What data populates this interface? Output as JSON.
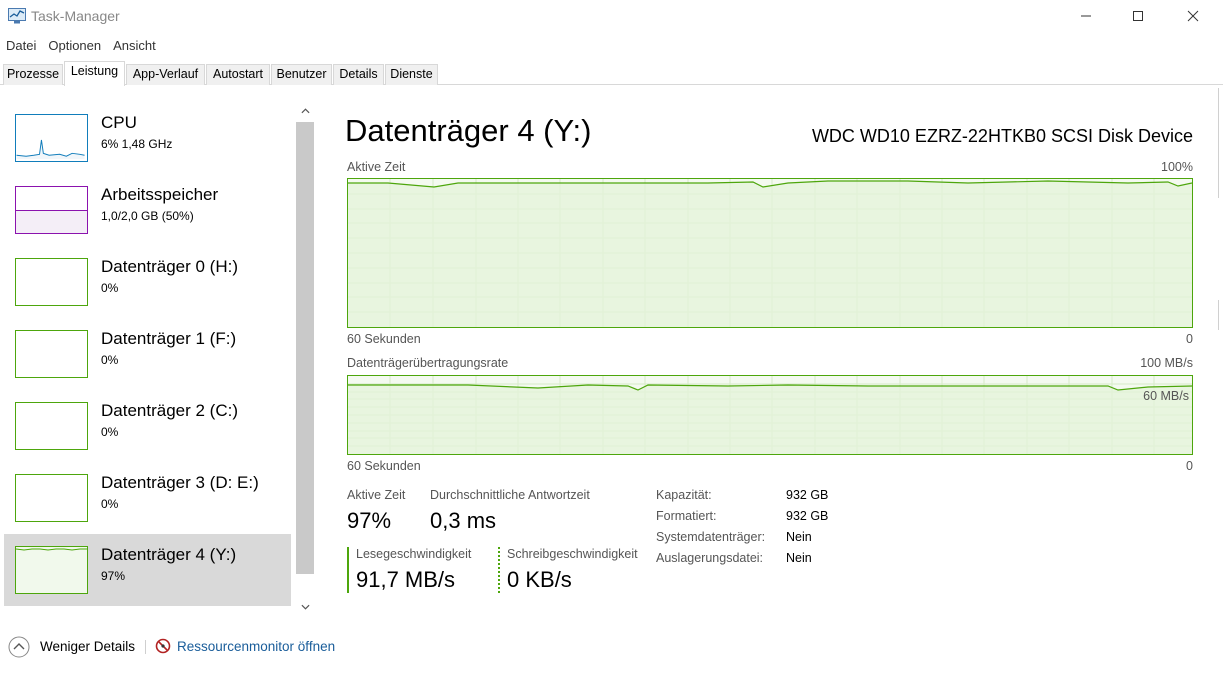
{
  "window": {
    "title": "Task-Manager"
  },
  "menu": [
    "Datei",
    "Optionen",
    "Ansicht"
  ],
  "tabs": [
    {
      "label": "Prozesse",
      "active": false
    },
    {
      "label": "Leistung",
      "active": true
    },
    {
      "label": "App-Verlauf",
      "active": false
    },
    {
      "label": "Autostart",
      "active": false
    },
    {
      "label": "Benutzer",
      "active": false
    },
    {
      "label": "Details",
      "active": false
    },
    {
      "label": "Dienste",
      "active": false
    }
  ],
  "sidebar": {
    "items": [
      {
        "title": "CPU",
        "sub": "6%  1,48 GHz",
        "color": "#117dbb",
        "selected": false
      },
      {
        "title": "Arbeitsspeicher",
        "sub": "1,0/2,0 GB (50%)",
        "color": "#8b12ae",
        "selected": false
      },
      {
        "title": "Datenträger 0 (H:)",
        "sub": "0%",
        "color": "#4da60c",
        "selected": false
      },
      {
        "title": "Datenträger 1 (F:)",
        "sub": "0%",
        "color": "#4da60c",
        "selected": false
      },
      {
        "title": "Datenträger 2 (C:)",
        "sub": "0%",
        "color": "#4da60c",
        "selected": false
      },
      {
        "title": "Datenträger 3 (D: E:)",
        "sub": "0%",
        "color": "#4da60c",
        "selected": false
      },
      {
        "title": "Datenträger 4 (Y:)",
        "sub": "97%",
        "color": "#4da60c",
        "selected": true
      }
    ]
  },
  "detail": {
    "title": "Datenträger 4 (Y:)",
    "model": "WDC WD10 EZRZ-22HTKB0 SCSI Disk Device",
    "graph1": {
      "label": "Aktive Zeit",
      "max_label": "100%",
      "x_left": "60 Sekunden",
      "x_right": "0"
    },
    "graph2": {
      "label": "Datenträgerübertragungsrate",
      "max_label": "100 MB/s",
      "mid_label": "60 MB/s",
      "x_left": "60 Sekunden",
      "x_right": "0"
    },
    "stats": {
      "active_time_label": "Aktive Zeit",
      "active_time_value": "97%",
      "response_label": "Durchschnittliche Antwortzeit",
      "response_value": "0,3 ms",
      "read_label": "Lesegeschwindigkeit",
      "read_value": "91,7 MB/s",
      "write_label": "Schreibgeschwindigkeit",
      "write_value": "0 KB/s"
    },
    "props": [
      {
        "key": "Kapazität:",
        "value": "932 GB"
      },
      {
        "key": "Formatiert:",
        "value": "932 GB"
      },
      {
        "key": "Systemdatenträger:",
        "value": "Nein"
      },
      {
        "key": "Auslagerungsdatei:",
        "value": "Nein"
      }
    ]
  },
  "footer": {
    "less_details": "Weniger Details",
    "resource_monitor": "Ressourcenmonitor öffnen"
  },
  "colors": {
    "disk_green": "#4da60c",
    "cpu_blue": "#117dbb",
    "memory_purple": "#8b12ae",
    "link": "#1a5d9a"
  }
}
